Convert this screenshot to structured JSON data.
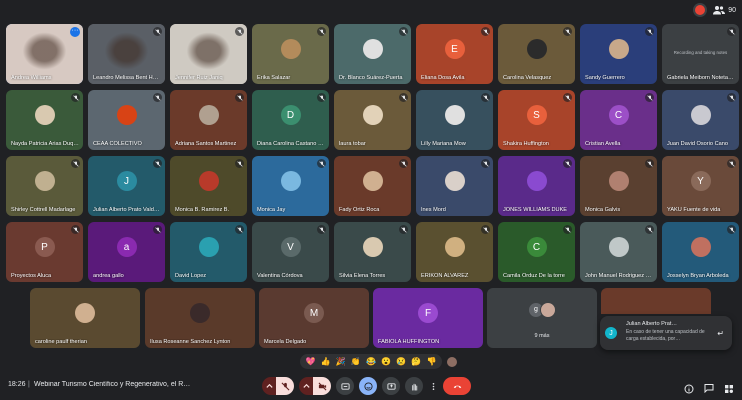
{
  "top": {
    "participant_count": "90"
  },
  "tiles": [
    {
      "name": "Andrea Williams",
      "bg": "#d7c9c2",
      "type": "video",
      "mic": "",
      "speaking": true,
      "menu": true
    },
    {
      "name": "Leandro Melissa Bent Hooker",
      "bg": "#5a5f66",
      "type": "video",
      "mic": "muted"
    },
    {
      "name": "Jennifer Ruiz Janiq",
      "bg": "#cfcac2",
      "type": "video",
      "mic": "muted"
    },
    {
      "name": "Erika Salazar",
      "bg": "#6a6a4a",
      "type": "photo",
      "avbg": "#b38b5b",
      "mic": "muted"
    },
    {
      "name": "Dr. Blanco Suárez-Puerta",
      "bg": "#4c6a6a",
      "type": "photo",
      "avbg": "#e0e0e0",
      "mic": "muted"
    },
    {
      "name": "Eliana Dosa Avila",
      "bg": "#a8442a",
      "type": "initial",
      "initial": "E",
      "avbg": "#e8603c",
      "mic": "muted"
    },
    {
      "name": "Carolina Velasquez",
      "bg": "#6b5a3a",
      "type": "photo",
      "avbg": "#2b2b2b",
      "mic": "muted"
    },
    {
      "name": "Sandy Guerrero",
      "bg": "#2a3e7a",
      "type": "photo",
      "avbg": "#c8a88a",
      "mic": "muted"
    },
    {
      "name": "Gabriela Meiborn Notetaker",
      "bg": "#3c4043",
      "type": "note",
      "note": "Recording and taking notes",
      "mic": "muted"
    },
    {
      "name": "Nayda Patricia Arias Duque",
      "bg": "#3a5a3a",
      "type": "photo",
      "avbg": "#d9c9b0",
      "mic": "muted"
    },
    {
      "name": "CEAA COLECTIVO",
      "bg": "#5c6770",
      "type": "photo",
      "avbg": "#d84315",
      "mic": "muted"
    },
    {
      "name": "Adriana Santos Martinez",
      "bg": "#6b3a2a",
      "type": "photo",
      "avbg": "#b0a090",
      "mic": "muted"
    },
    {
      "name": "Diana Carolina Castano Gir…",
      "bg": "#2f5e4e",
      "type": "initial",
      "initial": "D",
      "avbg": "#3b8f6f",
      "mic": "muted"
    },
    {
      "name": "laura tobar",
      "bg": "#6b5a3a",
      "type": "photo",
      "avbg": "#e2d2b8",
      "mic": "muted"
    },
    {
      "name": "Lilly Mariana Mow",
      "bg": "#37505e",
      "type": "photo",
      "avbg": "#e0e0e0",
      "mic": "muted"
    },
    {
      "name": "Shakira Huffington",
      "bg": "#a8442a",
      "type": "initial",
      "initial": "S",
      "avbg": "#e8603c",
      "mic": "muted"
    },
    {
      "name": "Cristian Avella",
      "bg": "#6a2f8a",
      "type": "initial",
      "initial": "C",
      "avbg": "#9c4fc7",
      "mic": "muted"
    },
    {
      "name": "Juan David Osorio Cano",
      "bg": "#3a4a6a",
      "type": "photo",
      "avbg": "#c9c9d0",
      "mic": "muted"
    },
    {
      "name": "Shirley Cottrell Madarlage",
      "bg": "#5a5a3a",
      "type": "photo",
      "avbg": "#c0b090",
      "mic": "muted"
    },
    {
      "name": "Julian Alberto Prato Valdarr…",
      "bg": "#235a6a",
      "type": "initial",
      "initial": "J",
      "avbg": "#2b8ba0",
      "mic": "muted"
    },
    {
      "name": "Monica B. Ramirez B.",
      "bg": "#4e4a2a",
      "type": "photo",
      "avbg": "#b83a2a",
      "mic": "muted"
    },
    {
      "name": "Monica Jay",
      "bg": "#2c6a9c",
      "type": "photo",
      "avbg": "#7ab8e0",
      "mic": "muted"
    },
    {
      "name": "Fady Ortiz Roca",
      "bg": "#6a3a2a",
      "type": "photo",
      "avbg": "#d0b090",
      "mic": "muted"
    },
    {
      "name": "Ines Mord",
      "bg": "#3a4a6a",
      "type": "photo",
      "avbg": "#d9d0c9",
      "mic": "muted"
    },
    {
      "name": "JONES WILLIAMS DUKE",
      "bg": "#5a2a8a",
      "type": "photo",
      "avbg": "#8a4ad0",
      "mic": "muted"
    },
    {
      "name": "Monica Galvis",
      "bg": "#5a4030",
      "type": "photo",
      "avbg": "#b08070",
      "mic": "muted"
    },
    {
      "name": "YAKU Fuente de vida",
      "bg": "#6a4a3a",
      "type": "initial",
      "initial": "Y",
      "avbg": "#8a6a5a",
      "mic": "muted"
    },
    {
      "name": "Proyectos Aluca",
      "bg": "#6a3a30",
      "type": "initial",
      "initial": "P",
      "avbg": "#8a5a50",
      "mic": "muted"
    },
    {
      "name": "andrea gallo",
      "bg": "#5a1a7a",
      "type": "initial",
      "initial": "a",
      "avbg": "#8a2ab0",
      "mic": "muted"
    },
    {
      "name": "David Lopez",
      "bg": "#235a6a",
      "type": "photo",
      "avbg": "#2aa0b0",
      "mic": "muted"
    },
    {
      "name": "Valentina Córdova",
      "bg": "#3a4a4a",
      "type": "initial",
      "initial": "V",
      "avbg": "#5a6a6a",
      "mic": "muted"
    },
    {
      "name": "Silvia Elena Torres",
      "bg": "#3a4a4a",
      "type": "photo",
      "avbg": "#d9c9b0",
      "mic": "muted"
    },
    {
      "name": "ERIKON ALVAREZ",
      "bg": "#5a5030",
      "type": "photo",
      "avbg": "#d0b080",
      "mic": "muted"
    },
    {
      "name": "Camila Orduz De la torre",
      "bg": "#2a5a2a",
      "type": "initial",
      "initial": "C",
      "avbg": "#3a8a3a",
      "mic": "muted"
    },
    {
      "name": "John Manuel Rodriguez Cor…",
      "bg": "#4a5a5a",
      "type": "photo",
      "avbg": "#c0c8c8",
      "mic": "muted"
    },
    {
      "name": "Josselyn Bryan Arboleda",
      "bg": "#235a7a",
      "type": "photo",
      "avbg": "#c07060",
      "mic": "muted"
    }
  ],
  "bottom_tiles": [
    {
      "name": "caroline paulf therian",
      "bg": "#5a4a30",
      "type": "photo",
      "avbg": "#d0b090",
      "mic": ""
    },
    {
      "name": "Ilusa Roseanne Sanchez Lynton",
      "bg": "#5a3a2a",
      "type": "photo",
      "avbg": "#3a2a2a",
      "mic": ""
    },
    {
      "name": "Marcela Delgado",
      "bg": "#5a3a30",
      "type": "initial",
      "initial": "M",
      "avbg": "#7a5a50",
      "mic": ""
    },
    {
      "name": "FABIOLA HUFFINGTON",
      "bg": "#6a2aa0",
      "type": "initial",
      "initial": "F",
      "avbg": "#9a4ad0",
      "mic": ""
    }
  ],
  "more": {
    "label": "9 más",
    "initial": "g"
  },
  "chat_toast": {
    "sender": "Julian Alberto Prat…",
    "initial": "J",
    "message": "En caso de tener una capacidad de carga establecida, por…"
  },
  "reactions": [
    "💖",
    "👍",
    "🎉",
    "👏",
    "😂",
    "😮",
    "😢",
    "🤔",
    "👎"
  ],
  "bottombar": {
    "time": "18:26",
    "separator": "|",
    "title": "Webinar Turismo Científico y Regenerativo, el Rol d…"
  }
}
